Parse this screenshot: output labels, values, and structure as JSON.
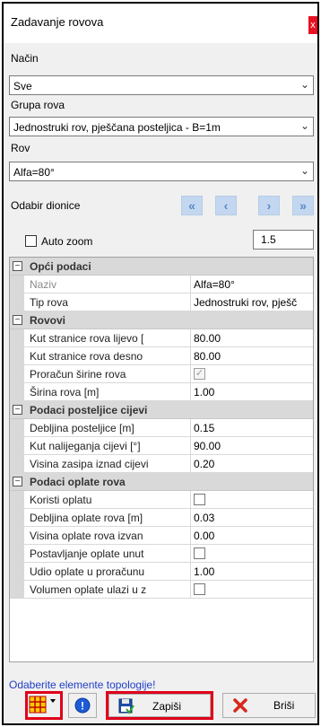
{
  "window": {
    "title": "Zadavanje rovova",
    "close_glyph": "x"
  },
  "fields": {
    "nacin": {
      "label": "Način",
      "value": "Sve"
    },
    "grupa": {
      "label": "Grupa rova",
      "value": "Jednostruki rov, pješčana posteljica - B=1m"
    },
    "rov": {
      "label": "Rov",
      "value": "Alfa=80°"
    }
  },
  "section_nav": {
    "label": "Odabir dionice",
    "first_glyph": "«",
    "prev_glyph": "‹",
    "next_glyph": "›",
    "last_glyph": "»"
  },
  "auto_zoom": {
    "label": "Auto zoom",
    "checked": false,
    "value": "1.5"
  },
  "properties": {
    "opci": {
      "title": "Opći podaci",
      "rows": [
        {
          "name": "Naziv",
          "value": "Alfa=80°"
        },
        {
          "name": "Tip rova",
          "value": "Jednostruki rov, pješč"
        }
      ]
    },
    "rovovi": {
      "title": "Rovovi",
      "rows": [
        {
          "name": "Kut stranice rova lijevo [",
          "value": "80.00"
        },
        {
          "name": "Kut stranice rova desno",
          "value": "80.00"
        },
        {
          "name": "Proračun širine rova",
          "value": ""
        },
        {
          "name": "Širina rova [m]",
          "value": "1.00"
        }
      ]
    },
    "posteljica": {
      "title": "Podaci posteljice cijevi",
      "rows": [
        {
          "name": "Debljina posteljice [m]",
          "value": "0.15"
        },
        {
          "name": "Kut nalijeganja cijevi [°]",
          "value": "90.00"
        },
        {
          "name": "Visina zasipa iznad cijevi",
          "value": "0.20"
        }
      ]
    },
    "oplata": {
      "title": "Podaci oplate rova",
      "rows": [
        {
          "name": "Koristi oplatu",
          "value": ""
        },
        {
          "name": "Debljina oplate rova [m]",
          "value": "0.03"
        },
        {
          "name": "Visina oplate rova izvan",
          "value": "0.00"
        },
        {
          "name": "Postavljanje oplate unut",
          "value": ""
        },
        {
          "name": "Udio oplate u proračunu",
          "value": "1.00"
        },
        {
          "name": "Volumen oplate ulazi u z",
          "value": ""
        }
      ]
    }
  },
  "status_text": "Odaberite elemente topologije!",
  "buttons": {
    "save": "Zapiši",
    "delete": "Briši"
  },
  "colors": {
    "close_red": "#e81123",
    "highlight_red": "#e0001b",
    "link_blue": "#1f3ec8",
    "nav_blue": "#5b86c5"
  }
}
